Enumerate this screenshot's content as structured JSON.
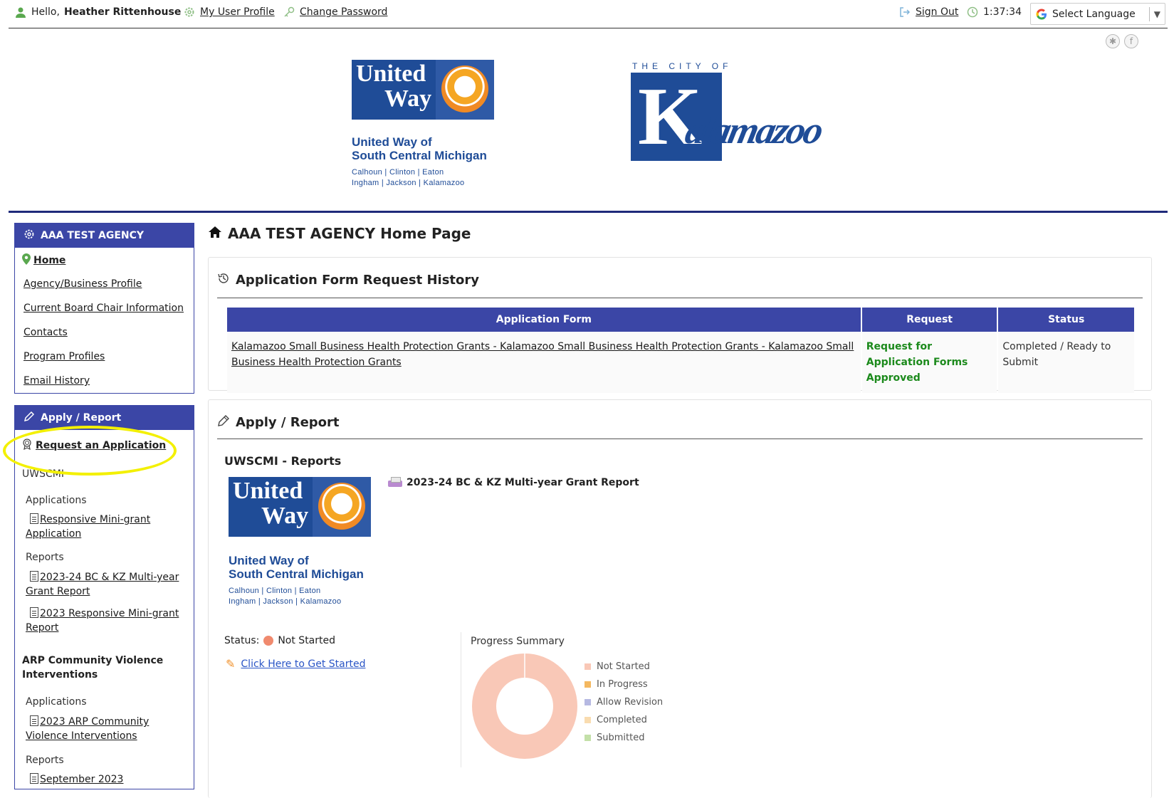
{
  "topbar": {
    "greeting_prefix": "Hello,",
    "user_name": "Heather Rittenhouse",
    "profile_link": "My User Profile",
    "password_link": "Change Password",
    "signout_link": "Sign Out",
    "clock": "1:37:34",
    "language": "Select Language"
  },
  "logos": {
    "uw_word1": "United",
    "uw_word2": "Way",
    "uw_name_line1": "United Way of",
    "uw_name_line2": "South Central Michigan",
    "uw_counties_line1": "Calhoun  |  Clinton  |  Eaton",
    "uw_counties_line2": "Ingham  |  Jackson  |  Kalamazoo",
    "city_of": "THE CITY OF",
    "city_k": "K",
    "city_script": "alamazoo"
  },
  "sidebar": {
    "agency_title": "AAA TEST AGENCY",
    "nav": [
      {
        "label": "Home"
      },
      {
        "label": "Agency/Business Profile"
      },
      {
        "label": "Current Board Chair Information"
      },
      {
        "label": "Contacts"
      },
      {
        "label": "Program Profiles"
      },
      {
        "label": "Email History"
      }
    ],
    "apply_title": "Apply / Report",
    "request_link": "Request an Application",
    "org1": "UWSCMI",
    "applications_label": "Applications",
    "reports_label": "Reports",
    "org1_app1": "Responsive Mini-grant Application",
    "org1_rep1": "2023-24 BC & KZ Multi-year Grant Report",
    "org1_rep2": "2023 Responsive Mini-grant Report",
    "org2": "ARP Community Violence Interventions",
    "org2_app1": "2023 ARP Community Violence Interventions",
    "org2_rep1": "September 2023"
  },
  "main": {
    "page_title": "AAA TEST AGENCY Home Page",
    "history": {
      "title": "Application Form Request History",
      "columns": [
        "Application Form",
        "Request",
        "Status"
      ],
      "rows": [
        {
          "form": "Kalamazoo Small Business Health Protection Grants - Kalamazoo Small Business Health Protection Grants - Kalamazoo Small Business Health Protection Grants",
          "request": "Request for Application Forms Approved",
          "status": "Completed / Ready to Submit"
        }
      ]
    },
    "apply": {
      "title": "Apply / Report",
      "subtitle": "UWSCMI - Reports",
      "report_name": "2023-24 BC & KZ Multi-year Grant Report",
      "status_label": "Status:",
      "status_value": "Not Started",
      "start_link": "Click Here to Get Started",
      "progress_title": "Progress Summary"
    }
  },
  "chart_data": {
    "type": "pie",
    "title": "Progress Summary",
    "categories": [
      "Not Started",
      "In Progress",
      "Allow Revision",
      "Completed",
      "Submitted"
    ],
    "values": [
      1,
      0,
      0,
      0,
      0
    ],
    "colors": [
      "#f9c8b7",
      "#f4b860",
      "#b6b9e2",
      "#f9dcb0",
      "#c3e0a8"
    ],
    "legend_position": "right",
    "donut": true
  }
}
